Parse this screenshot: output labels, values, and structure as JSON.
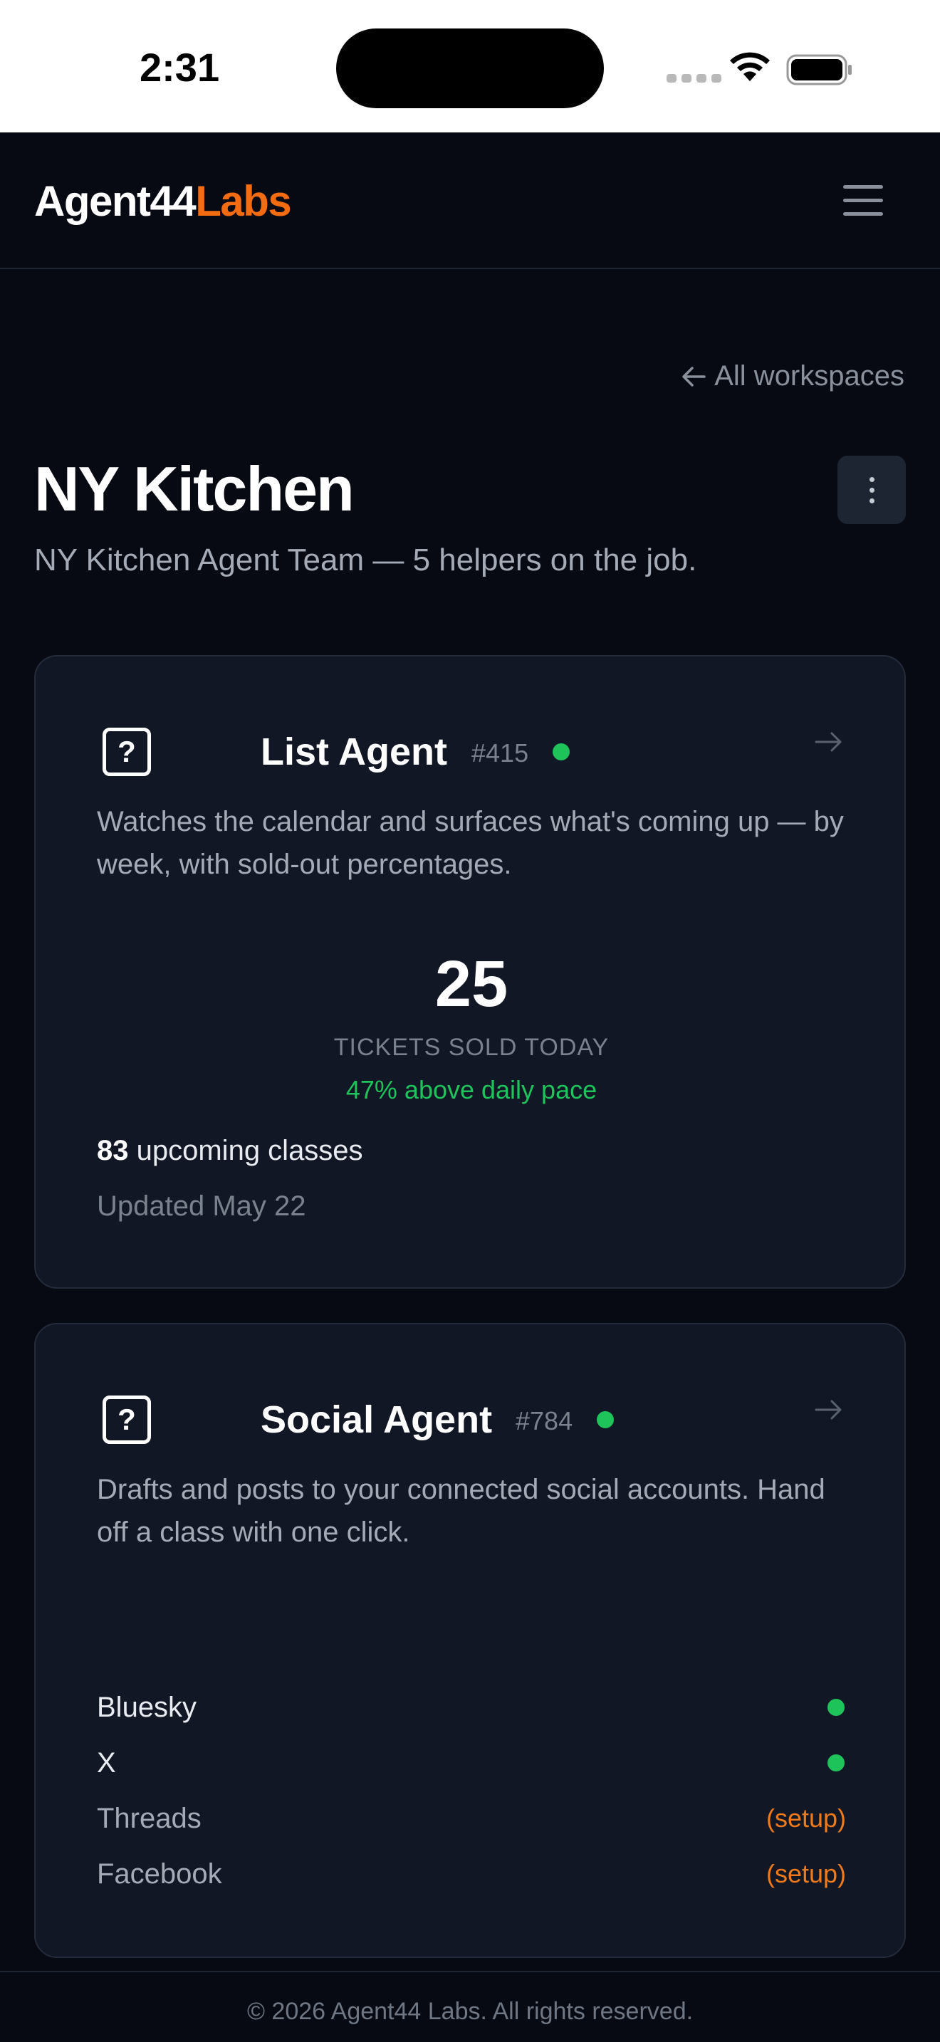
{
  "status_bar": {
    "time": "2:31"
  },
  "brand": {
    "part1": "Agent44",
    "part2": "Labs",
    "accent_color": "#f36c12"
  },
  "nav": {
    "back_label": "All workspaces",
    "menu_icon": "hamburger-menu-icon"
  },
  "workspace": {
    "title": "NY Kitchen",
    "subtitle": "NY Kitchen Agent Team — 5 helpers on the job."
  },
  "agents": [
    {
      "icon": "question-mark-icon",
      "name": "List Agent",
      "number": "#415",
      "status": "online",
      "description": "Watches the calendar and surfaces what's coming up — by week, with sold-out percentages.",
      "stat_value": "25",
      "stat_label": "TICKETS SOLD TODAY",
      "stat_delta": "47% above daily pace",
      "upcoming_count": "83",
      "upcoming_label": "upcoming classes",
      "updated": "Updated May 22"
    },
    {
      "icon": "question-mark-icon",
      "name": "Social Agent",
      "number": "#784",
      "status": "online",
      "description": "Drafts and posts to your connected social accounts. Hand off a class with one click.",
      "accounts": [
        {
          "name": "Bluesky",
          "connected": true,
          "action": ""
        },
        {
          "name": "X",
          "connected": true,
          "action": ""
        },
        {
          "name": "Threads",
          "connected": false,
          "action": "(setup)"
        },
        {
          "name": "Facebook",
          "connected": false,
          "action": "(setup)"
        }
      ]
    }
  ],
  "footer": {
    "text": "© 2026 Agent44 Labs. All rights reserved."
  }
}
